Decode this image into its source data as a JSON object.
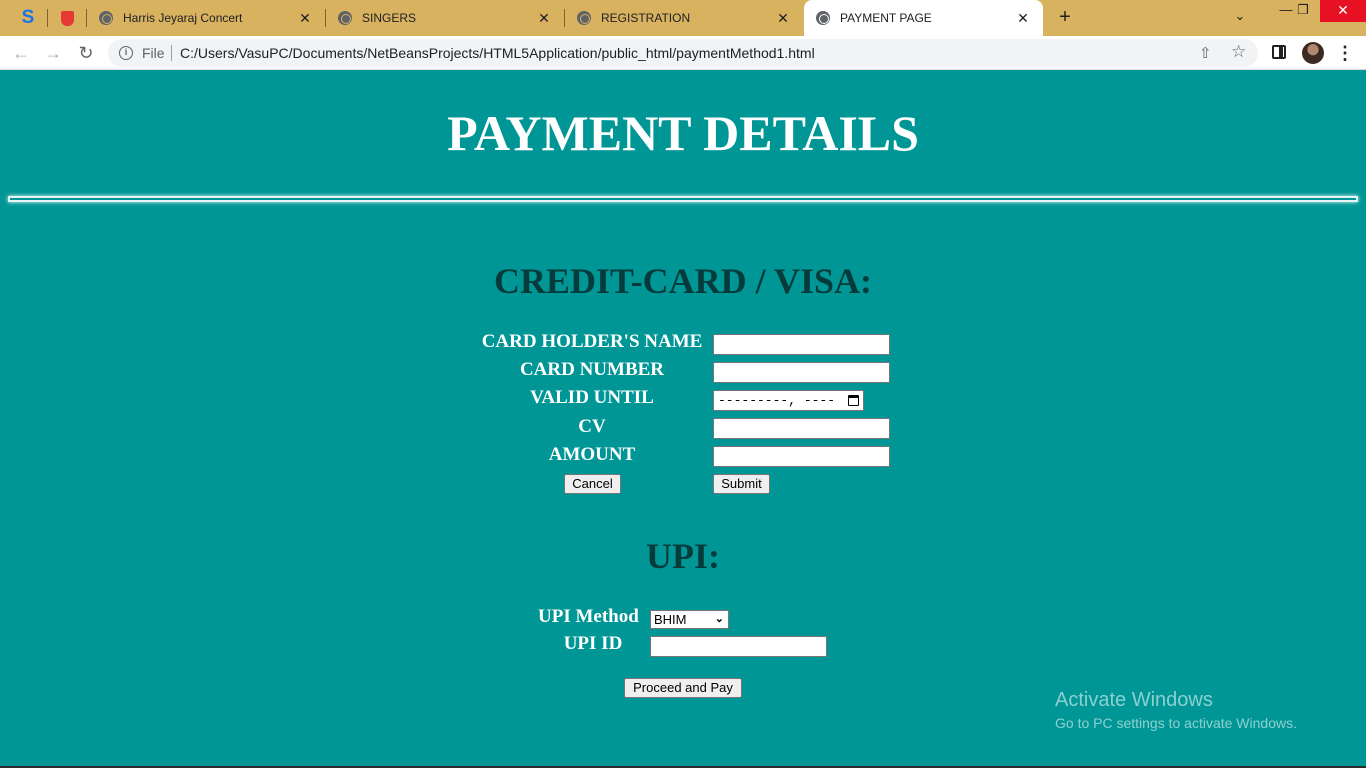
{
  "browser": {
    "pinned_tabs": [
      "S"
    ],
    "tabs": [
      {
        "title": "Harris Jeyaraj Concert"
      },
      {
        "title": "SINGERS"
      },
      {
        "title": "REGISTRATION"
      },
      {
        "title": "PAYMENT PAGE",
        "active": true
      }
    ],
    "tab_close_glyph": "✕",
    "new_tab_glyph": "+",
    "address": {
      "scheme_label": "File",
      "url": "C:/Users/VasuPC/Documents/NetBeansProjects/HTML5Application/public_html/paymentMethod1.html"
    },
    "icons": [
      "back-arrow-icon",
      "forward-arrow-icon",
      "reload-icon",
      "info-icon",
      "share-icon",
      "star-icon",
      "side-panel-icon",
      "avatar",
      "kebab-menu-icon",
      "tab-search-icon",
      "minimize-icon",
      "maximize-icon",
      "close-window-icon"
    ]
  },
  "page": {
    "title": "PAYMENT DETAILS",
    "credit_card": {
      "heading": "CREDIT-CARD / VISA:",
      "fields": {
        "holder_name": {
          "label": "CARD HOLDER'S NAME",
          "value": ""
        },
        "card_number": {
          "label": "CARD NUMBER",
          "value": ""
        },
        "valid_until": {
          "label": "VALID UNTIL",
          "value": "---------, ----"
        },
        "cv": {
          "label": "CV",
          "value": ""
        },
        "amount": {
          "label": "AMOUNT",
          "value": ""
        }
      },
      "cancel_label": "Cancel",
      "submit_label": "Submit"
    },
    "upi": {
      "heading": "UPI:",
      "method_label": "UPI Method",
      "method_selected": "BHIM",
      "id_label": "UPI ID",
      "id_value": "",
      "proceed_label": "Proceed and Pay"
    }
  },
  "watermark": {
    "title": "Activate Windows",
    "subtitle": "Go to PC settings to activate Windows."
  },
  "colors": {
    "page_background": "#009696",
    "heading_dark": "#063b3b",
    "tab_strip": "#d9b260",
    "window_close": "#e81123"
  }
}
